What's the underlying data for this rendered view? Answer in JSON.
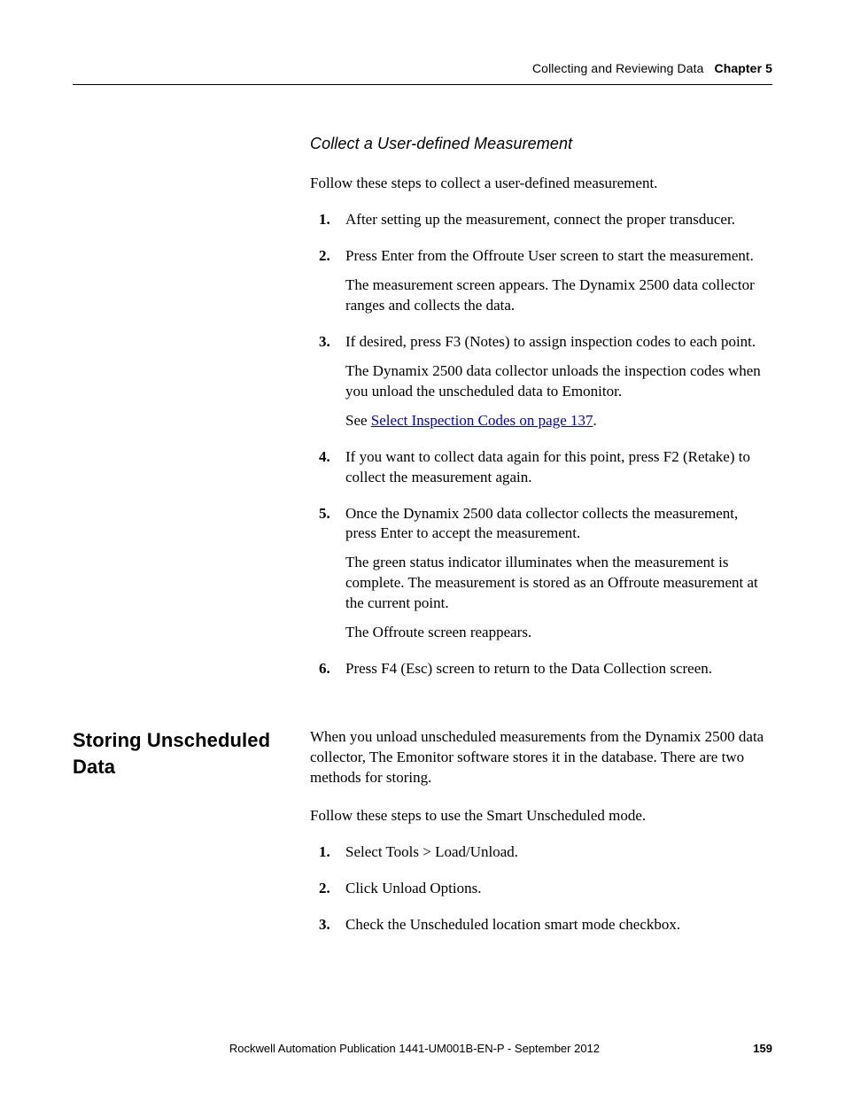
{
  "header": {
    "section_title": "Collecting and Reviewing Data",
    "chapter_label": "Chapter 5"
  },
  "sub1": {
    "heading": "Collect a User-defined Measurement",
    "intro": "Follow these steps to collect a user-defined measurement.",
    "steps": [
      {
        "num": "1.",
        "text": "After setting up the measurement, connect the proper transducer."
      },
      {
        "num": "2.",
        "text": "Press Enter from the Offroute User screen to start the measurement.",
        "after": [
          "The measurement screen appears. The Dynamix 2500 data collector ranges and collects the data."
        ]
      },
      {
        "num": "3.",
        "text": "If desired, press F3 (Notes) to assign inspection codes to each point.",
        "after": [
          "The Dynamix 2500 data collector unloads the inspection codes when you unload the unscheduled data to Emonitor."
        ],
        "see_prefix": "See ",
        "see_link": "Select Inspection Codes on page 137",
        "see_suffix": "."
      },
      {
        "num": "4.",
        "text": "If you want to collect data again for this point, press F2 (Retake) to collect the measurement again."
      },
      {
        "num": "5.",
        "text": "Once the Dynamix 2500 data collector collects the measurement, press Enter to accept the measurement.",
        "after": [
          "The green status indicator illuminates when the measurement is complete. The measurement is stored as an Offroute measurement at the current point.",
          "The Offroute screen reappears."
        ]
      },
      {
        "num": "6.",
        "text": "Press F4 (Esc) screen to return to the Data Collection screen."
      }
    ]
  },
  "sub2": {
    "heading": "Storing Unscheduled Data",
    "intro": "When you unload unscheduled measurements from the Dynamix 2500 data collector, The Emonitor software stores it in the database. There are two methods for storing.",
    "lead": "Follow these steps to use the Smart Unscheduled mode.",
    "steps": [
      {
        "num": "1.",
        "text": "Select Tools > Load/Unload."
      },
      {
        "num": "2.",
        "text": "Click Unload Options."
      },
      {
        "num": "3.",
        "text": "Check the Unscheduled location smart mode checkbox."
      }
    ]
  },
  "footer": {
    "publication": "Rockwell Automation Publication 1441-UM001B-EN-P - September 2012",
    "page": "159"
  }
}
